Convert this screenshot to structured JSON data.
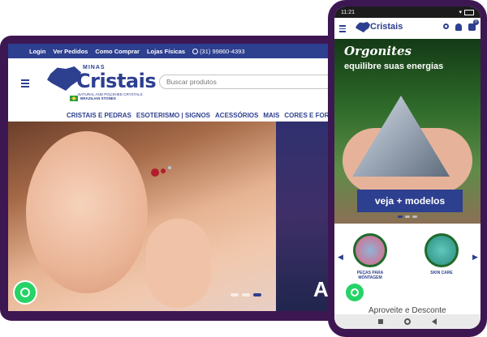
{
  "desktop": {
    "topbar": {
      "login": "Login",
      "orders": "Ver Pedidos",
      "how_to_buy": "Como Comprar",
      "stores": "Lojas Físicas",
      "phone": "(31) 99860-4393"
    },
    "logo": {
      "brand_top": "MINAS",
      "brand_main": "Cristais",
      "tagline": "NATURAL AND POLISHED CRYSTALS",
      "badge": "BRAZILIAN STONES"
    },
    "search": {
      "placeholder": "Buscar produtos"
    },
    "nav": {
      "items": [
        "CRISTAIS E PEDRAS",
        "ESOTERISMO | SIGNOS",
        "ACESSÓRIOS",
        "MAIS",
        "CORES E FORM"
      ]
    },
    "hero": {
      "second_slide_text": "Ac"
    }
  },
  "mobile": {
    "status": {
      "time": "11:21"
    },
    "header": {
      "brand": "Cristais",
      "cart_count": "0"
    },
    "banner": {
      "title": "Orgonites",
      "subtitle": "equilibre suas energias",
      "cta": "veja + modelos"
    },
    "categories": [
      {
        "label": "PEÇAS PARA MONTAGEM"
      },
      {
        "label": "SKIN CARE"
      }
    ],
    "section_title": "Aproveite e Desconte"
  },
  "colors": {
    "brand_blue": "#2d3f8f",
    "frame_purple": "#3d1752",
    "whatsapp_green": "#25d366"
  }
}
